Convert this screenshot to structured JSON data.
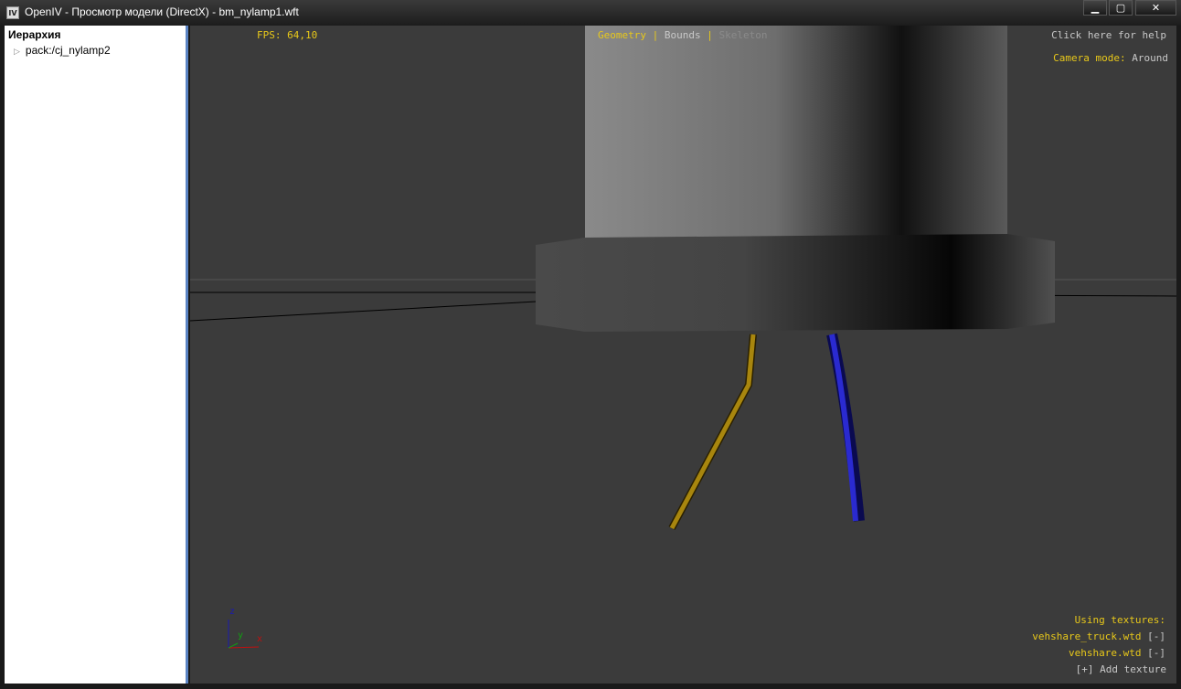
{
  "window": {
    "icon": "IV",
    "title": "OpenIV - Просмотр модели (DirectX) - bm_nylamp1.wft",
    "minimize": "▁",
    "maximize": "▢",
    "close": "✕"
  },
  "sidebar": {
    "title": "Иерархия",
    "items": [
      {
        "label": "pack:/cj_nylamp2"
      }
    ]
  },
  "viewport": {
    "fps": "FPS: 64,10",
    "tabs": [
      {
        "label": "Geometry"
      },
      {
        "label": "Bounds"
      },
      {
        "label": "Skeleton"
      }
    ],
    "separator": "|",
    "help": "Click here for help",
    "camera_label": "Camera mode:",
    "camera_value": "Around",
    "textures_title": "Using textures:",
    "textures": [
      {
        "name": "vehshare_truck.wtd",
        "remove": "[-]"
      },
      {
        "name": "vehshare.wtd",
        "remove": "[-]"
      }
    ],
    "add_texture": "[+] Add texture",
    "axes": {
      "z": "z",
      "y": "y",
      "x": "x"
    },
    "colors": {
      "accent": "#e8c81a",
      "background": "#3b3b3b"
    }
  }
}
